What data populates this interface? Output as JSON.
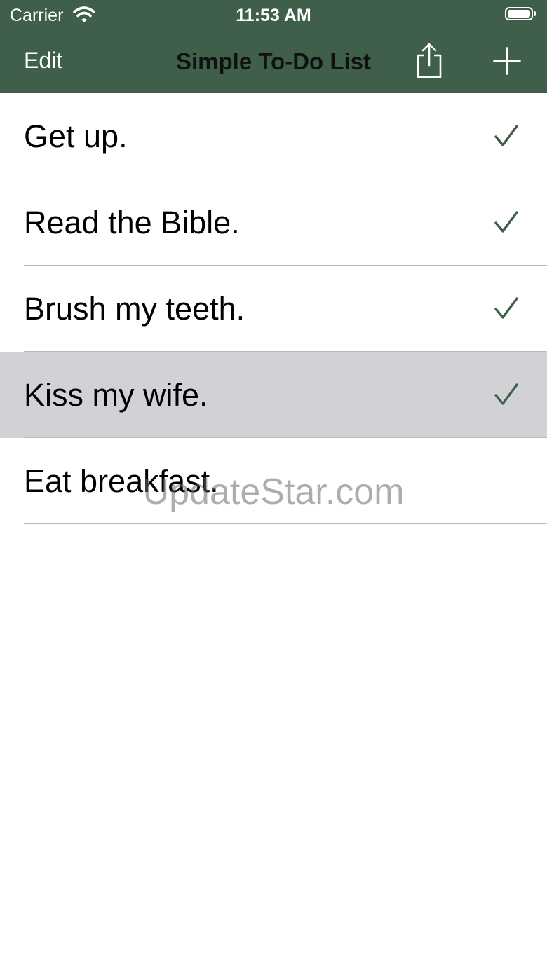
{
  "status_bar": {
    "carrier": "Carrier",
    "time": "11:53 AM",
    "wifi_icon": "wifi-icon",
    "battery_icon": "battery-full-icon"
  },
  "nav": {
    "edit_label": "Edit",
    "title": "Simple To-Do List",
    "share_icon": "share-icon",
    "add_icon": "plus-icon",
    "bar_color": "#3f5f4b"
  },
  "todos": [
    {
      "text": "Get up.",
      "done": true
    },
    {
      "text": "Read the Bible.",
      "done": true
    },
    {
      "text": "Brush my teeth.",
      "done": true
    },
    {
      "text": "Kiss my wife.",
      "done": true,
      "selected": true
    },
    {
      "text": "Eat breakfast.",
      "done": false
    }
  ],
  "check_color": "#3f5f4b",
  "watermark": "UpdateStar.com"
}
